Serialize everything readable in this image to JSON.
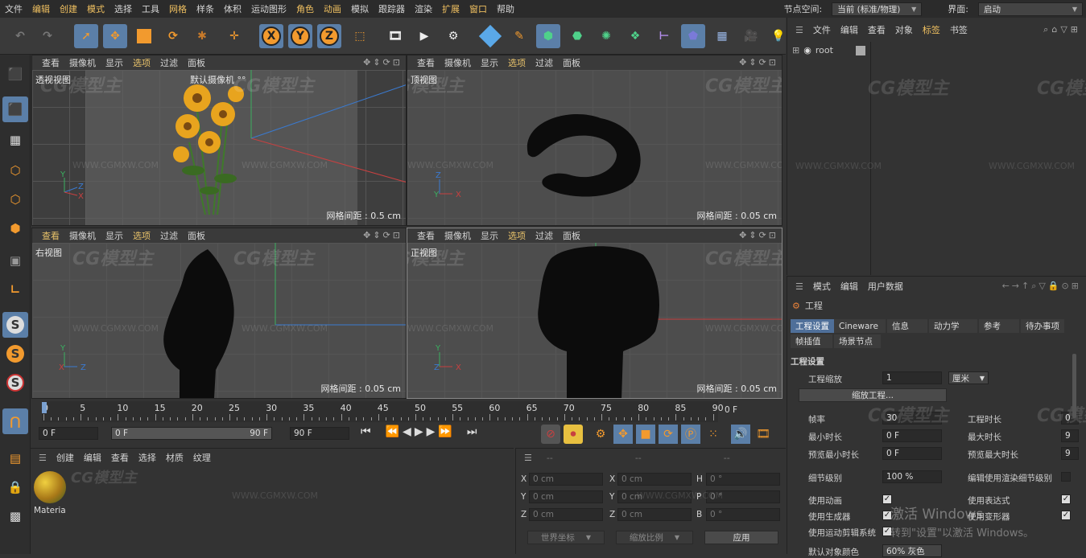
{
  "menu": [
    "文件",
    "编辑",
    "创建",
    "模式",
    "选择",
    "工具",
    "网格",
    "样条",
    "体积",
    "运动图形",
    "角色",
    "动画",
    "模拟",
    "跟踪器",
    "渲染",
    "扩展",
    "窗口",
    "帮助"
  ],
  "node_space": {
    "label": "节点空间:",
    "value": "当前 (标准/物理)"
  },
  "layout": {
    "label": "界面:",
    "value": "启动"
  },
  "toolbar": {
    "x": "X",
    "y": "Y",
    "z": "Z"
  },
  "left_tools": {
    "s1": "S",
    "s2": "S",
    "s3": "S"
  },
  "viewports": [
    {
      "menu": [
        "查看",
        "摄像机",
        "显示",
        "选项",
        "过滤",
        "面板"
      ],
      "label": "透视视图",
      "camera": "默认摄像机 °°",
      "grid": "网格间距 : 0.5 cm"
    },
    {
      "menu": [
        "查看",
        "摄像机",
        "显示",
        "选项",
        "过滤",
        "面板"
      ],
      "label": "顶视图",
      "grid": "网格间距 : 0.05 cm"
    },
    {
      "menu": [
        "查看",
        "摄像机",
        "显示",
        "选项",
        "过滤",
        "面板"
      ],
      "label": "右视图",
      "grid": "网格间距 : 0.05 cm"
    },
    {
      "menu": [
        "查看",
        "摄像机",
        "显示",
        "选项",
        "过滤",
        "面板"
      ],
      "label": "正视图",
      "grid": "网格间距 : 0.05 cm"
    }
  ],
  "axes": {
    "x": "X",
    "y": "Y",
    "z": "Z"
  },
  "watermark": {
    "logo": "CG模型主",
    "url": "WWW.CGMXW.COM"
  },
  "timeline": {
    "ticks": [
      "0",
      "5",
      "10",
      "15",
      "20",
      "25",
      "30",
      "35",
      "40",
      "45",
      "50",
      "55",
      "60",
      "65",
      "70",
      "75",
      "80",
      "85",
      "90"
    ],
    "current_frame": "0 F",
    "start": "0 F",
    "range_start": "0 F",
    "range_end": "90 F",
    "end": "90 F"
  },
  "material_mgr": {
    "menu": [
      "创建",
      "编辑",
      "查看",
      "选择",
      "材质",
      "纹理"
    ],
    "material_name": "Materia"
  },
  "coords": {
    "header": [
      "--",
      "--",
      "--"
    ],
    "rows": [
      {
        "a": "X",
        "av": "0 cm",
        "b": "X",
        "bv": "0 cm",
        "c": "H",
        "cv": "0 °"
      },
      {
        "a": "Y",
        "av": "0 cm",
        "b": "Y",
        "bv": "0 cm",
        "c": "P",
        "cv": "0 °"
      },
      {
        "a": "Z",
        "av": "0 cm",
        "b": "Z",
        "bv": "0 cm",
        "c": "B",
        "cv": "0 °"
      }
    ],
    "world": "世界坐标",
    "scale": "缩放比例",
    "apply": "应用"
  },
  "object_mgr": {
    "menu": [
      "文件",
      "编辑",
      "查看",
      "对象",
      "标签",
      "书签"
    ],
    "root": "root"
  },
  "attr_mgr": {
    "menu": [
      "模式",
      "编辑",
      "用户数据"
    ],
    "title": "工程",
    "tabs": [
      "工程设置",
      "Cineware",
      "信息",
      "动力学",
      "参考",
      "待办事项"
    ],
    "tabs2": [
      "帧插值",
      "场景节点"
    ],
    "section": "工程设置",
    "scale_label": "工程缩放",
    "scale_value": "1",
    "scale_unit": "厘米",
    "scale_btn": "缩放工程...",
    "fps_label": "帧率",
    "fps_value": "30",
    "dur_label": "工程时长",
    "dur_value": "0",
    "min_label": "最小时长",
    "min_value": "0 F",
    "max_label": "最大时长",
    "max_value": "9",
    "pmin_label": "预览最小时长",
    "pmin_value": "0 F",
    "pmax_label": "预览最大时长",
    "pmax_value": "9",
    "lod_label": "细节级别",
    "lod_value": "100 %",
    "render_lod_label": "编辑使用渲染细节级别",
    "anim_label": "使用动画",
    "expr_label": "使用表达式",
    "gen_label": "使用生成器",
    "deform_label": "使用变形器",
    "motion_label": "使用运动剪辑系统",
    "last_label": "默认对象颜色",
    "last_value": "60% 灰色",
    "activate1": "激活 Windows",
    "activate2": "转到\"设置\"以激活 Windows。"
  }
}
